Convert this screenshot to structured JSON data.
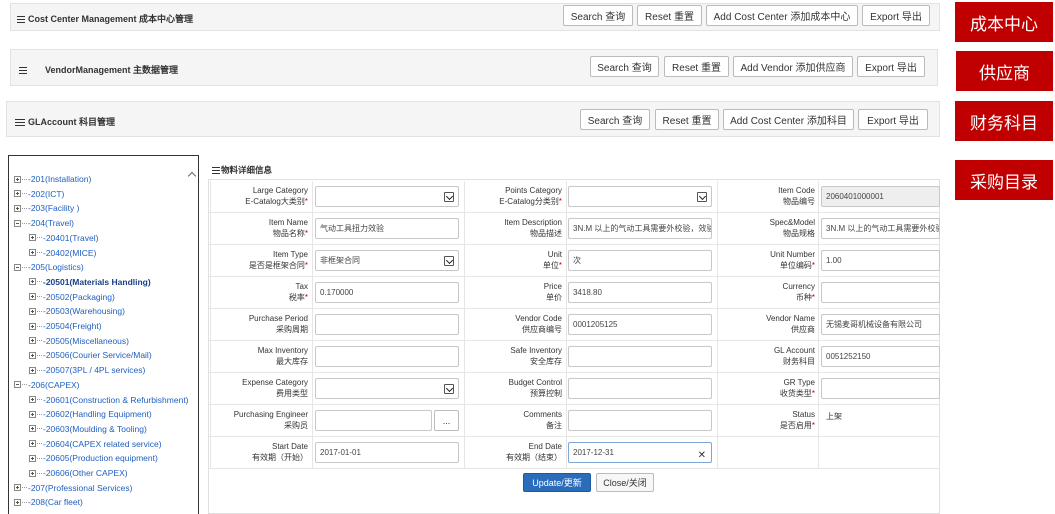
{
  "panels": {
    "cost_center": {
      "title": "Cost Center Management 成本中心管理",
      "buttons": [
        "Search 查询",
        "Reset 重置",
        "Add Cost Center 添加成本中心",
        "Export 导出"
      ]
    },
    "vendor": {
      "title": "VendorManagement 主数据管理",
      "buttons": [
        "Search 查询",
        "Reset 重置",
        "Add Vendor 添加供应商",
        "Export 导出"
      ]
    },
    "gl_account": {
      "title": "GLAccount 科目管理",
      "buttons": [
        "Search 查询",
        "Reset 重置",
        "Add Cost Center 添加科目",
        "Export 导出"
      ]
    }
  },
  "side_tags": [
    "成本中心",
    "供应商",
    "财务科目",
    "采购目录"
  ],
  "colors": {
    "tag_red": "#c00000",
    "primary_blue": "#2a6ebb",
    "tree_link": "#1f5fbf"
  },
  "tree": [
    {
      "label": "-201(Installation)",
      "level": 0,
      "toggle": "plus"
    },
    {
      "label": "-202(ICT)",
      "level": 0,
      "toggle": "plus"
    },
    {
      "label": "-203(Facility )",
      "level": 0,
      "toggle": "plus"
    },
    {
      "label": "-204(Travel)",
      "level": 0,
      "toggle": "minus"
    },
    {
      "label": "-20401(Travel)",
      "level": 1,
      "toggle": "plus"
    },
    {
      "label": "-20402(MICE)",
      "level": 1,
      "toggle": "plus"
    },
    {
      "label": "-205(Logistics)",
      "level": 0,
      "toggle": "minus"
    },
    {
      "label": "-20501(Materials Handling)",
      "level": 1,
      "toggle": "plus",
      "selected": true
    },
    {
      "label": "-20502(Packaging)",
      "level": 1,
      "toggle": "plus"
    },
    {
      "label": "-20503(Warehousing)",
      "level": 1,
      "toggle": "plus"
    },
    {
      "label": "-20504(Freight)",
      "level": 1,
      "toggle": "plus"
    },
    {
      "label": "-20505(Miscellaneous)",
      "level": 1,
      "toggle": "plus"
    },
    {
      "label": "-20506(Courier Service/Mail)",
      "level": 1,
      "toggle": "plus"
    },
    {
      "label": "-20507(3PL / 4PL services)",
      "level": 1,
      "toggle": "plus"
    },
    {
      "label": "-206(CAPEX)",
      "level": 0,
      "toggle": "minus"
    },
    {
      "label": "-20601(Construction & Refurbishment)",
      "level": 1,
      "toggle": "plus"
    },
    {
      "label": "-20602(Handling Equipment)",
      "level": 1,
      "toggle": "plus"
    },
    {
      "label": "-20603(Moulding & Tooling)",
      "level": 1,
      "toggle": "plus"
    },
    {
      "label": "-20604(CAPEX related service)",
      "level": 1,
      "toggle": "plus"
    },
    {
      "label": "-20605(Production equipment)",
      "level": 1,
      "toggle": "plus"
    },
    {
      "label": "-20606(Other CAPEX)",
      "level": 1,
      "toggle": "plus"
    },
    {
      "label": "-207(Professional Services)",
      "level": 0,
      "toggle": "plus"
    },
    {
      "label": "-208(Car fleet)",
      "level": 0,
      "toggle": "plus"
    }
  ],
  "form": {
    "title": "物料详细信息",
    "rows": [
      [
        {
          "en": "Large Category",
          "zh": "E-Catalog大类别",
          "req": true,
          "type": "select",
          "value": ""
        },
        {
          "en": "Points Category",
          "zh": "E-Catalog分类别",
          "req": true,
          "type": "select",
          "value": ""
        },
        {
          "en": "Item Code",
          "zh": "物品编号",
          "req": false,
          "type": "readonly",
          "value": "2060401000001"
        }
      ],
      [
        {
          "en": "Item Name",
          "zh": "物品名称",
          "req": true,
          "type": "text",
          "value": "气动工具扭力效验"
        },
        {
          "en": "Item Description",
          "zh": "物品描述",
          "req": false,
          "type": "text",
          "value": "3N.M 以上的气动工具需要外校验，效验"
        },
        {
          "en": "Spec&Model",
          "zh": "物品规格",
          "req": false,
          "type": "text",
          "value": "3N.M 以上的气动工具需要外校验"
        }
      ],
      [
        {
          "en": "Item Type",
          "zh": "是否是框架合同",
          "req": true,
          "type": "select",
          "value": "非框架合同"
        },
        {
          "en": "Unit",
          "zh": "单位",
          "req": true,
          "type": "text",
          "value": "次"
        },
        {
          "en": "Unit Number",
          "zh": "单位编码",
          "req": true,
          "type": "text",
          "value": "1.00"
        }
      ],
      [
        {
          "en": "Tax",
          "zh": "税率",
          "req": true,
          "type": "text",
          "value": "0.170000"
        },
        {
          "en": "Price",
          "zh": "单价",
          "req": false,
          "type": "text",
          "value": "3418.80"
        },
        {
          "en": "Currency",
          "zh": "币种",
          "req": true,
          "type": "text",
          "value": ""
        }
      ],
      [
        {
          "en": "Purchase Period",
          "zh": "采购周期",
          "req": false,
          "type": "text",
          "value": ""
        },
        {
          "en": "Vendor Code",
          "zh": "供应商编号",
          "req": false,
          "type": "text",
          "value": "0001205125"
        },
        {
          "en": "Vendor Name",
          "zh": "供应商",
          "req": false,
          "type": "text",
          "value": "无锡麦哥机械设备有限公司"
        }
      ],
      [
        {
          "en": "Max Inventory",
          "zh": "最大库存",
          "req": false,
          "type": "text",
          "value": ""
        },
        {
          "en": "Safe Inventory",
          "zh": "安全库存",
          "req": false,
          "type": "text",
          "value": ""
        },
        {
          "en": "GL Account",
          "zh": "财务科目",
          "req": false,
          "type": "text",
          "value": "0051252150"
        }
      ],
      [
        {
          "en": "Expense Category",
          "zh": "费用类型",
          "req": false,
          "type": "select",
          "value": ""
        },
        {
          "en": "Budget Control",
          "zh": "预算控制",
          "req": false,
          "type": "text",
          "value": ""
        },
        {
          "en": "GR Type",
          "zh": "收货类型",
          "req": true,
          "type": "text",
          "value": ""
        }
      ],
      [
        {
          "en": "Purchasing Engineer",
          "zh": "采购员",
          "req": false,
          "type": "browse",
          "value": "",
          "browse_label": "..."
        },
        {
          "en": "Comments",
          "zh": "备注",
          "req": false,
          "type": "text",
          "value": ""
        },
        {
          "en": "Status",
          "zh": "是否启用",
          "req": true,
          "type": "plain",
          "value": "上架"
        }
      ],
      [
        {
          "en": "Start Date",
          "zh": "有效期（开始）",
          "req": false,
          "type": "text",
          "value": "2017-01-01"
        },
        {
          "en": "End Date",
          "zh": "有效期（结束）",
          "req": false,
          "type": "clear",
          "value": "2017-12-31"
        },
        null
      ]
    ],
    "update_label": "Update/更新",
    "close_label": "Close/关闭"
  }
}
